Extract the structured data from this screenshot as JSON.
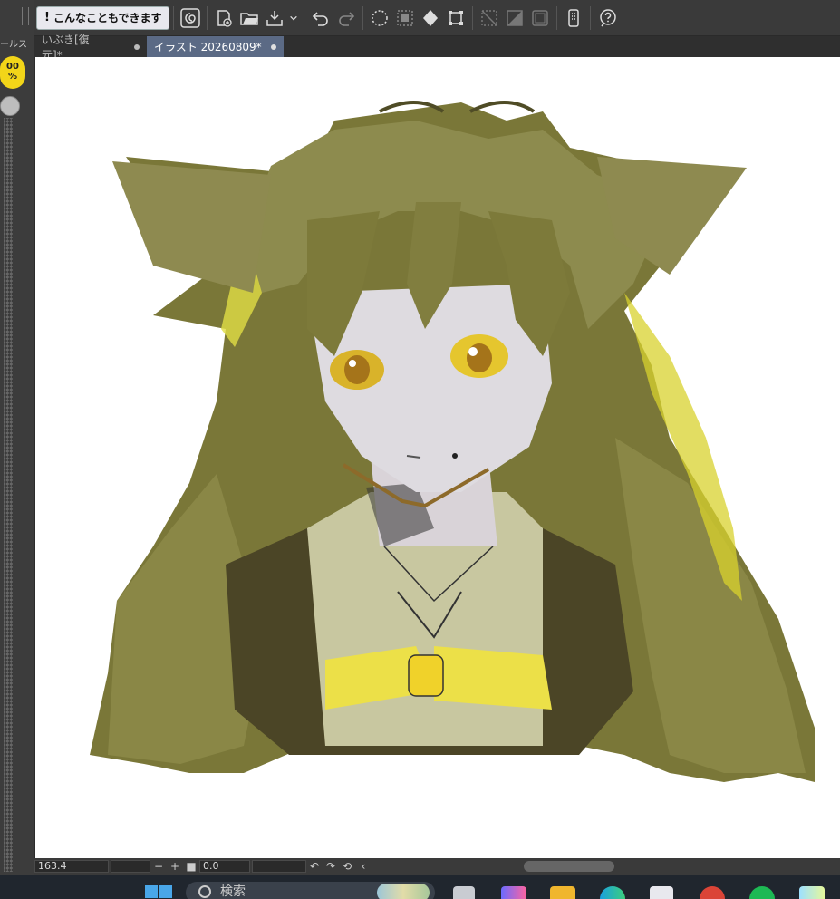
{
  "left_panel": {
    "title": "ールス",
    "zoom_value": "00",
    "zoom_unit": "%"
  },
  "toolbar": {
    "hint_button": "こんなこともできます",
    "icons": [
      "spiral-logo-icon",
      "new-file-icon",
      "open-folder-icon",
      "save-dropdown-icon",
      "undo-icon",
      "redo-icon",
      "selection-clear-icon",
      "selection-invert-icon",
      "fill-icon",
      "transform-icon",
      "hide-selection-icon",
      "selection-edge-icon",
      "ruler-icon",
      "smartphone-icon",
      "help-icon"
    ]
  },
  "tabs": [
    {
      "label": "いぶき[復元]*",
      "active": false
    },
    {
      "label": "イラスト 20260809*",
      "active": true
    }
  ],
  "status": {
    "zoom": "163.4",
    "minus": "−",
    "plus": "+",
    "stop": "■",
    "angle": "0.0",
    "rotate_left": "↶",
    "rotate_right": "↷",
    "reset": "⟲",
    "collapse": "‹"
  },
  "taskbar": {
    "search_placeholder": "検索",
    "apps": [
      "task-view-icon",
      "copilot-icon",
      "file-explorer-icon",
      "edge-icon",
      "store-icon",
      "chrome-icon",
      "spotify-icon",
      "photos-icon"
    ]
  },
  "colors": {
    "hair": "#7d7a3a",
    "hair_dark": "#4f4c26",
    "accent_yellow": "#f2d519",
    "skin": "#dedbe0",
    "tab_active": "#5b6a85"
  }
}
